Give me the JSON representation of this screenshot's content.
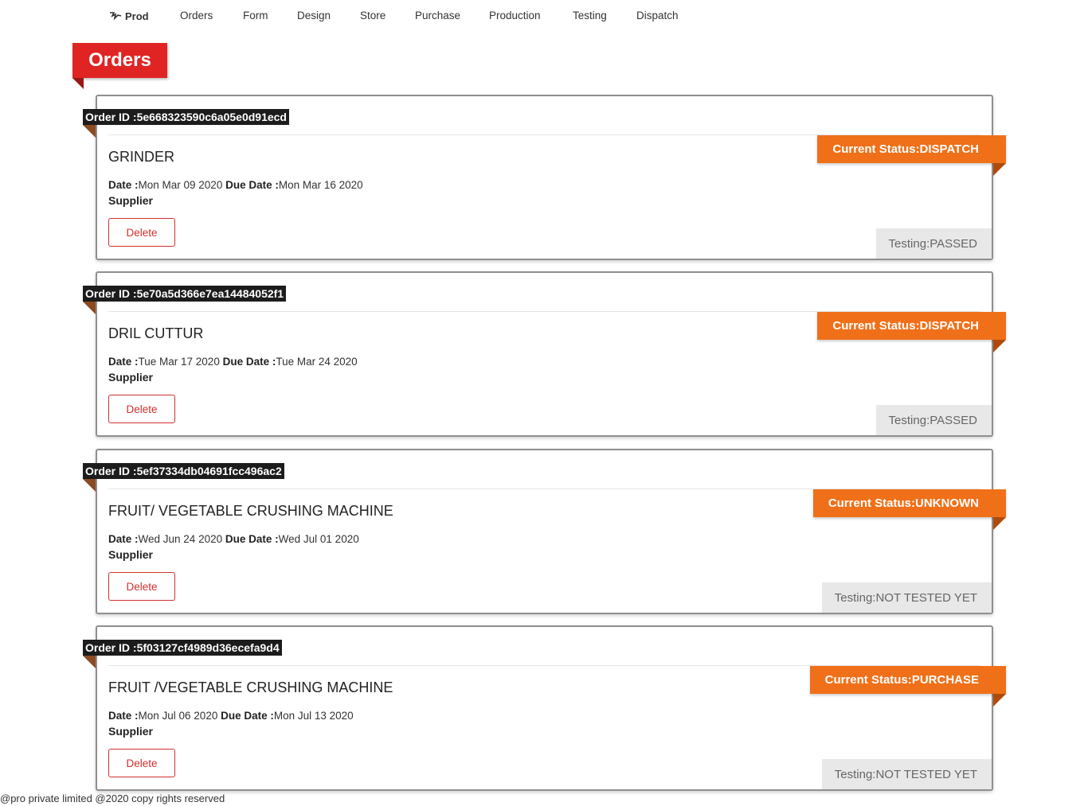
{
  "navbar": {
    "brand": "Prod",
    "items": [
      "Orders",
      "Form",
      "Design",
      "Store",
      "Purchase",
      "Production",
      "Testing",
      "Dispatch"
    ]
  },
  "page": {
    "title": "Orders"
  },
  "labels": {
    "order_id": "Order ID :",
    "date": "Date :",
    "due_date": "Due Date :",
    "supplier": "Supplier",
    "delete": "Delete",
    "current_status": "Current Status: ",
    "testing": "Testing: "
  },
  "orders": [
    {
      "id": "5e668323590c6a05e0d91ecd",
      "title": "GRINDER",
      "date": "Mon Mar 09 2020",
      "due_date": "Mon Mar 16 2020",
      "status": "DISPATCH",
      "testing": "PASSED"
    },
    {
      "id": "5e70a5d366e7ea14484052f1",
      "title": "DRIL CUTTUR",
      "date": "Tue Mar 17 2020",
      "due_date": "Tue Mar 24 2020",
      "status": "DISPATCH",
      "testing": "PASSED"
    },
    {
      "id": "5ef37334db04691fcc496ac2",
      "title": "FRUIT/ VEGETABLE CRUSHING MACHINE",
      "date": "Wed Jun 24 2020",
      "due_date": "Wed Jul 01 2020",
      "status": "UNKNOWN",
      "testing": "NOT TESTED YET"
    },
    {
      "id": "5f03127cf4989d36ecefa9d4",
      "title": "FRUIT /VEGETABLE CRUSHING MACHINE",
      "date": "Mon Jul 06 2020",
      "due_date": "Mon Jul 13 2020",
      "status": "PURCHASE",
      "testing": "NOT TESTED YET"
    }
  ],
  "footer": {
    "text": "@pro private limited @2020 copy rights reserved"
  },
  "colors": {
    "page_ribbon": "#e02424",
    "status_ribbon": "#f07019",
    "order_id_tag": "#1c1c1c",
    "delete_button": "#d32f2f",
    "testing_badge": "#e8e8e8"
  }
}
